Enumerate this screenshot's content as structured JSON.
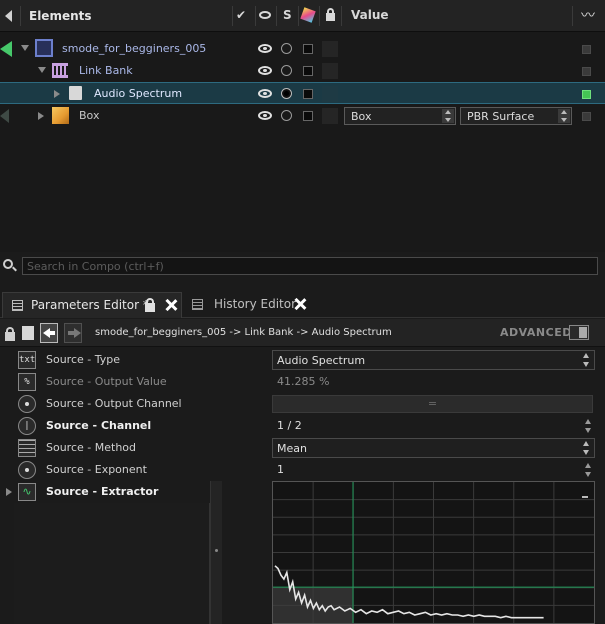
{
  "elements_panel": {
    "header": {
      "title": "Elements",
      "value_col": "Value",
      "solo_col": "S"
    },
    "rows": [
      {
        "label": "smode_for_begginers_005"
      },
      {
        "label": "Link Bank"
      },
      {
        "label": "Audio Spectrum"
      },
      {
        "label": "Box",
        "value1": "Box",
        "value2": "PBR Surface"
      }
    ],
    "status_on_color": "#44c454",
    "selection_color": "#1b3a45"
  },
  "search": {
    "placeholder": "Search in Compo (ctrl+f)"
  },
  "tabs": [
    {
      "label": "Parameters Editor *"
    },
    {
      "label": "History Editor"
    }
  ],
  "param_toolbar": {
    "breadcrumb": "smode_for_begginers_005 -> Link Bank -> Audio Spectrum",
    "advanced_label": "ADVANCED"
  },
  "params": [
    {
      "icon_text": "txt",
      "label": "Source - Type",
      "value": "Audio Spectrum"
    },
    {
      "icon_text": "%",
      "label": "Source - Output Value",
      "value": "41.285 %"
    },
    {
      "label": "Source - Output Channel",
      "value": "="
    },
    {
      "label": "Source - Channel",
      "value": "1  / 2"
    },
    {
      "label": "Source - Method",
      "value": "Mean"
    },
    {
      "label": "Source - Exponent",
      "value": "1"
    },
    {
      "label": "Source - Extractor"
    }
  ],
  "chart_data": {
    "type": "line",
    "series": [
      {
        "values": [
          40,
          38,
          33,
          30,
          35,
          22,
          28,
          15,
          20,
          12,
          18,
          9,
          14,
          8,
          12,
          7,
          10,
          6,
          9,
          10,
          7,
          9,
          6,
          8,
          5,
          7,
          4,
          6,
          5,
          7,
          4,
          5,
          6,
          4,
          5,
          3,
          4,
          5,
          3,
          4,
          3,
          4,
          3,
          3,
          2,
          3,
          2,
          3,
          2,
          2,
          2,
          1,
          2,
          1,
          1,
          1,
          1,
          1,
          1,
          1
        ]
      }
    ],
    "ylim": [
      0,
      100
    ],
    "grid": true,
    "threshold_line_y": 24,
    "line_color": "#e6e6e6",
    "grid_color": "#3a3a3a",
    "accent_color": "#1f9a5a"
  }
}
